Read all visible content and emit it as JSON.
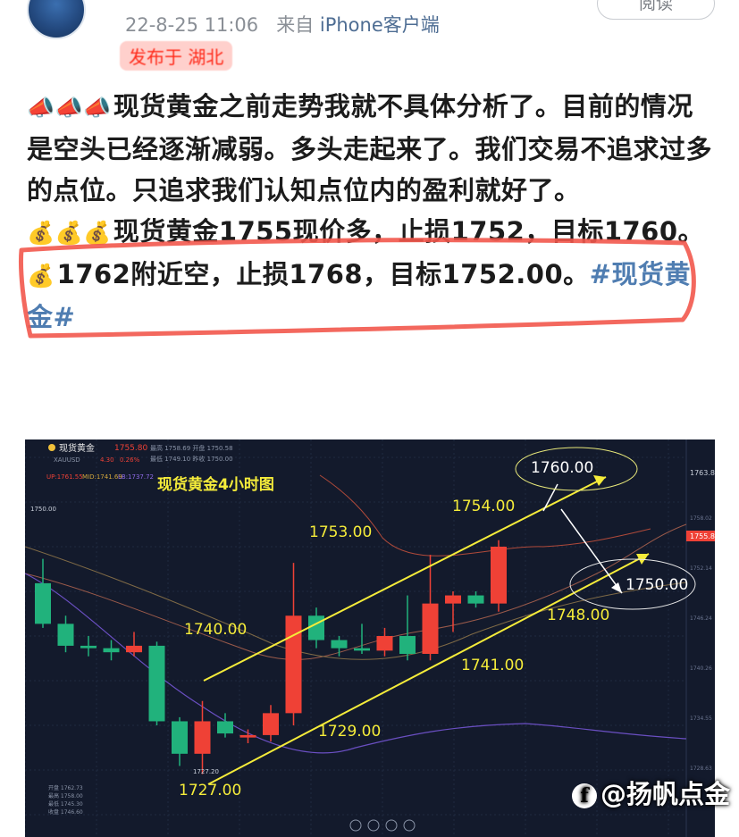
{
  "header": {
    "timestamp": "22-8-25 11:06",
    "source_prefix": "来自",
    "source_device": "iPhone客户端",
    "location": "发布于 湖北",
    "read_button": "阅读"
  },
  "post": {
    "line1_icons": "📣📣📣",
    "line1_text": "现货黄金之前走势我就不具体分析了。目前的情况是空头已经逐渐减弱。多头走起来了。我们交易不追求过多的点位。只追求我们认知点位内的盈利就好了。",
    "line2_icons": "💰💰💰",
    "line2_text": "现货黄金1755现价多，止损1752，目标1760。",
    "line3_icon": "💰",
    "line3_text": "1762附近空，止损1768，目标1752.00。",
    "hashtag": "#现货黄金#"
  },
  "chart": {
    "symbol": "现货黄金",
    "code": "XAUUSD",
    "price": "1755.80",
    "change": "4.30",
    "change_pct": "0.26%",
    "info_top": "最高 1758.69   开盘 1750.58",
    "info_bottom": "最低 1749.10   昨收 1750.00",
    "indicator_upper": "UP:1761.55",
    "indicator_mid": "MID:1741.69",
    "indicator_lower": "LB:1737.72",
    "title": "现货黄金4小时图",
    "axis_ticks": [
      "1763.83",
      "1755.80",
      "1750.00"
    ],
    "last_price_tag": "1755.80",
    "annotations": [
      "1760.00",
      "1754.00",
      "1753.00",
      "1750.00",
      "1748.00",
      "1740.00",
      "1741.00",
      "1729.00",
      "1727.00"
    ],
    "left_label": "1750.00",
    "bottom_info": [
      "开盘 1762.73",
      "最高 1758.00",
      "最低 1745.30",
      "收盘 1746.60"
    ],
    "bull_color": "#ef4136",
    "bear_color": "#21b27c"
  },
  "chart_data": {
    "type": "candlestick",
    "title": "现货黄金4小时图",
    "series": [
      {
        "name": "XAUUSD",
        "candles": [
          {
            "o": 1750.5,
            "h": 1753.5,
            "l": 1745.0,
            "c": 1745.5
          },
          {
            "o": 1745.5,
            "h": 1746.5,
            "l": 1742.0,
            "c": 1742.8
          },
          {
            "o": 1742.8,
            "h": 1744.0,
            "l": 1741.5,
            "c": 1742.5
          },
          {
            "o": 1742.5,
            "h": 1743.5,
            "l": 1741.0,
            "c": 1742.0
          },
          {
            "o": 1742.0,
            "h": 1744.5,
            "l": 1741.5,
            "c": 1742.8
          },
          {
            "o": 1742.8,
            "h": 1743.3,
            "l": 1733.0,
            "c": 1733.5
          },
          {
            "o": 1733.5,
            "h": 1734.0,
            "l": 1728.0,
            "c": 1729.5
          },
          {
            "o": 1729.5,
            "h": 1736.0,
            "l": 1727.0,
            "c": 1733.5
          },
          {
            "o": 1733.5,
            "h": 1734.5,
            "l": 1731.5,
            "c": 1732.0
          },
          {
            "o": 1731.5,
            "h": 1732.5,
            "l": 1730.8,
            "c": 1731.8
          },
          {
            "o": 1731.8,
            "h": 1735.5,
            "l": 1731.0,
            "c": 1734.5
          },
          {
            "o": 1734.5,
            "h": 1753.0,
            "l": 1733.0,
            "c": 1746.5
          },
          {
            "o": 1746.5,
            "h": 1747.5,
            "l": 1742.5,
            "c": 1743.5
          },
          {
            "o": 1743.5,
            "h": 1744.0,
            "l": 1741.5,
            "c": 1742.5
          },
          {
            "o": 1742.5,
            "h": 1745.5,
            "l": 1741.8,
            "c": 1742.2
          },
          {
            "o": 1742.2,
            "h": 1745.0,
            "l": 1741.5,
            "c": 1744.0
          },
          {
            "o": 1744.0,
            "h": 1749.0,
            "l": 1741.0,
            "c": 1741.8
          },
          {
            "o": 1741.8,
            "h": 1754.0,
            "l": 1741.0,
            "c": 1748.0
          },
          {
            "o": 1748.0,
            "h": 1749.5,
            "l": 1744.5,
            "c": 1749.0
          },
          {
            "o": 1749.0,
            "h": 1749.5,
            "l": 1747.5,
            "c": 1748.0
          },
          {
            "o": 1748.0,
            "h": 1755.8,
            "l": 1747.0,
            "c": 1755.0
          }
        ]
      }
    ]
  }
}
